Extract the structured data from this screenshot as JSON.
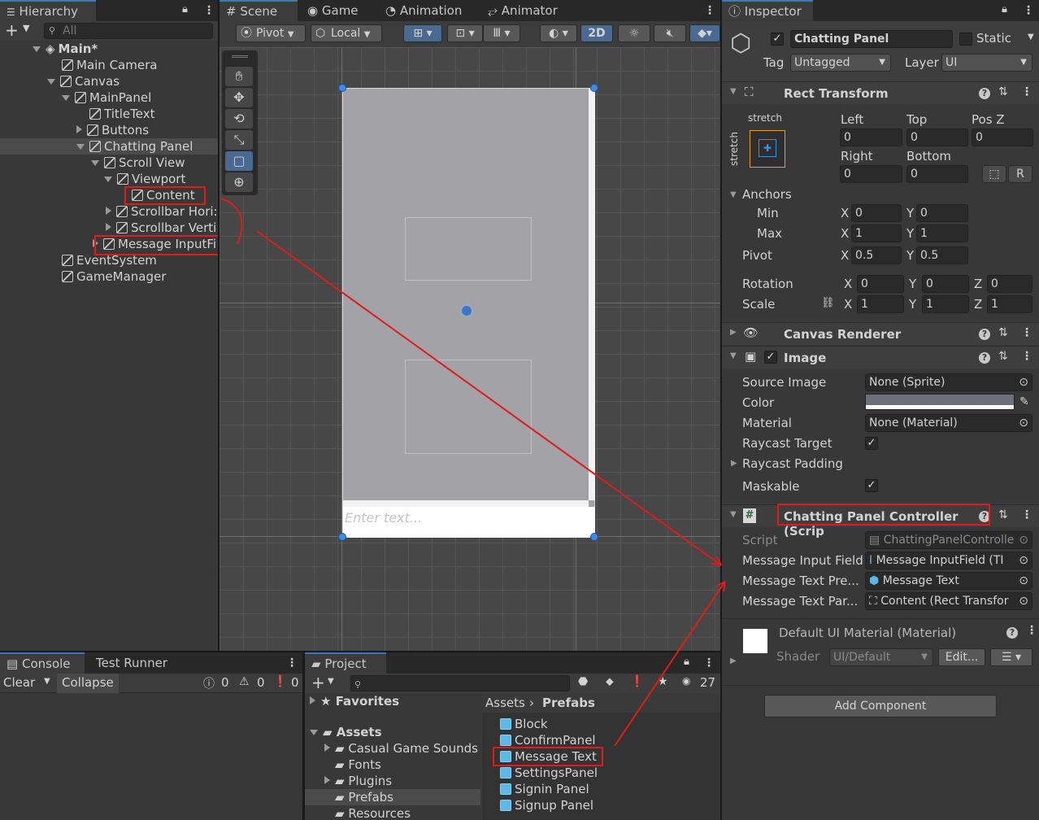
{
  "hierarchy": {
    "tab": "Hierarchy",
    "search_placeholder": "All",
    "rows": [
      {
        "label": "Main*"
      },
      {
        "label": "Main Camera"
      },
      {
        "label": "Canvas"
      },
      {
        "label": "MainPanel"
      },
      {
        "label": "TitleText"
      },
      {
        "label": "Buttons"
      },
      {
        "label": "Chatting Panel"
      },
      {
        "label": "Scroll View"
      },
      {
        "label": "Viewport"
      },
      {
        "label": "Content"
      },
      {
        "label": "Scrollbar Hori:"
      },
      {
        "label": "Scrollbar Verti"
      },
      {
        "label": "Message InputFi"
      },
      {
        "label": "EventSystem"
      },
      {
        "label": "GameManager"
      }
    ]
  },
  "scene": {
    "tabs": [
      "Scene",
      "Game",
      "Animation",
      "Animator"
    ],
    "pivot": "Pivot",
    "local": "Local",
    "mode_2d": "2D",
    "input_placeholder": "Enter text..."
  },
  "inspector": {
    "tab": "Inspector",
    "object_name": "Chatting Panel",
    "static_label": "Static",
    "tag_label": "Tag",
    "tag_value": "Untagged",
    "layer_label": "Layer",
    "layer_value": "UI",
    "rect_transform": {
      "title": "Rect Transform",
      "stretch_h": "stretch",
      "stretch_v": "stretch",
      "left_label": "Left",
      "left": "0",
      "top_label": "Top",
      "top": "0",
      "posz_label": "Pos Z",
      "posz": "0",
      "right_label": "Right",
      "right": "0",
      "bottom_label": "Bottom",
      "bottom": "0",
      "anchors_label": "Anchors",
      "min_label": "Min",
      "min_x": "0",
      "min_y": "0",
      "max_label": "Max",
      "max_x": "1",
      "max_y": "1",
      "pivot_label": "Pivot",
      "pivot_x": "0.5",
      "pivot_y": "0.5",
      "rotation_label": "Rotation",
      "rot_x": "0",
      "rot_y": "0",
      "rot_z": "0",
      "scale_label": "Scale",
      "scale_x": "1",
      "scale_y": "1",
      "scale_z": "1",
      "x": "X",
      "y": "Y",
      "z": "Z",
      "r": "R"
    },
    "canvas_renderer": {
      "title": "Canvas Renderer"
    },
    "image": {
      "title": "Image",
      "source_image_label": "Source Image",
      "source_image": "None (Sprite)",
      "color_label": "Color",
      "material_label": "Material",
      "material": "None (Material)",
      "raycast_target_label": "Raycast Target",
      "raycast_padding_label": "Raycast Padding",
      "maskable_label": "Maskable"
    },
    "controller": {
      "title": "Chatting Panel Controller (Scrip",
      "script_label": "Script",
      "script": "ChattingPanelControlle",
      "input_field_label": "Message Input Field",
      "input_field": "Message InputField (TI",
      "prefab_label": "Message Text Pre...",
      "prefab": "Message Text",
      "parent_label": "Message Text Par...",
      "parent": "Content (Rect Transfor"
    },
    "material_block": {
      "title": "Default UI Material (Material)",
      "shader_label": "Shader",
      "shader": "UI/Default",
      "edit": "Edit..."
    },
    "add_component": "Add Component"
  },
  "console": {
    "tabs": [
      "Console",
      "Test Runner"
    ],
    "clear": "Clear",
    "collapse": "Collapse",
    "counts": [
      "0",
      "0",
      "0"
    ]
  },
  "project": {
    "tab": "Project",
    "count": "27",
    "favorites": "Favorites",
    "assets": "Assets",
    "folders": [
      "Casual Game Sounds",
      "Fonts",
      "Plugins",
      "Prefabs",
      "Resources"
    ],
    "breadcrumb": [
      "Assets",
      "Prefabs"
    ],
    "prefabs": [
      "Block",
      "ConfirmPanel",
      "Message Text",
      "SettingsPanel",
      "Signin Panel",
      "Signup Panel"
    ]
  },
  "colors": {
    "annotation": "#e01b1b",
    "selection": "#4a6a94",
    "image_color": "#6b717c"
  }
}
